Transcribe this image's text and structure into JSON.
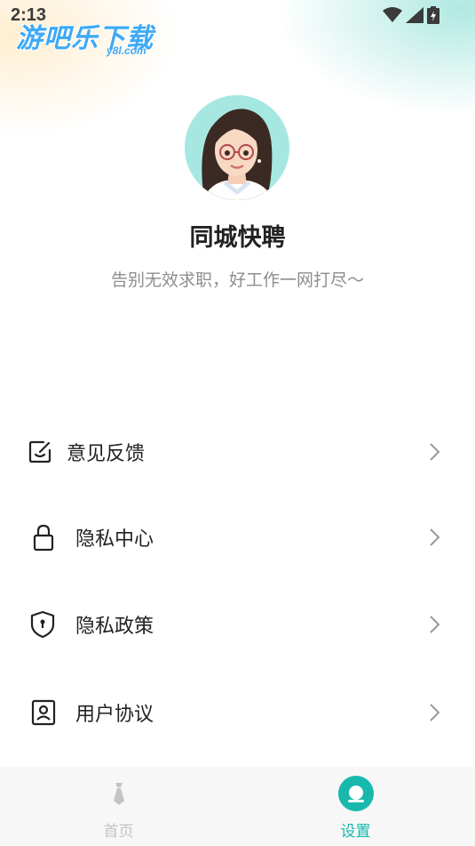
{
  "status_bar": {
    "time": "2:13"
  },
  "watermark": {
    "text": "游吧乐下载",
    "sub": "y8l.com"
  },
  "profile": {
    "app_name": "同城快聘",
    "slogan": "告别无效求职，好工作一网打尽～"
  },
  "menu": [
    {
      "label": "意见反馈",
      "icon": "feedback-icon"
    },
    {
      "label": "隐私中心",
      "icon": "lock-icon"
    },
    {
      "label": "隐私政策",
      "icon": "shield-icon"
    },
    {
      "label": "用户协议",
      "icon": "user-agreement-icon"
    }
  ],
  "bottom_nav": {
    "home_label": "首页",
    "settings_label": "设置",
    "active": "settings"
  },
  "colors": {
    "accent": "#18b8ad",
    "inactive": "#c4c4c4",
    "watermark": "#3fa9f5"
  }
}
